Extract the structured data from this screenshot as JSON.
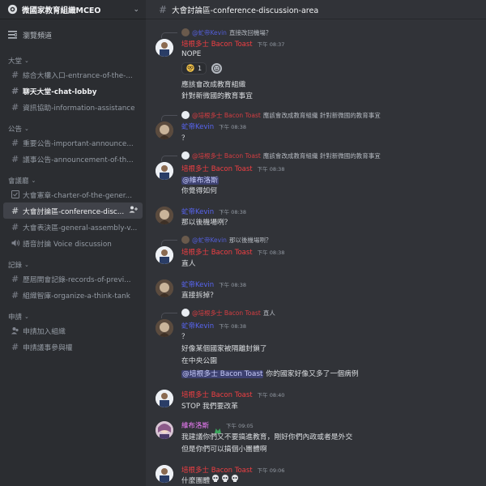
{
  "server": {
    "name": "微國家教育組織MCEO"
  },
  "sidebar": {
    "browse_label": "瀏覽頻道",
    "categories": [
      {
        "label": "大堂"
      },
      {
        "label": "公告"
      },
      {
        "label": "會議廳"
      },
      {
        "label": "記錄"
      },
      {
        "label": "申請"
      }
    ],
    "channels": [
      {
        "label": "綜合大樓入口-entrance-of-the-..."
      },
      {
        "label": "聊天大堂-chat-lobby"
      },
      {
        "label": "資訊協助-information-assistance"
      },
      {
        "label": "重要公告-important-announce..."
      },
      {
        "label": "議事公告-announcement-of-th..."
      },
      {
        "label": "大會憲章-charter-of-the-gener..."
      },
      {
        "label": "大會討論區-conference-disc..."
      },
      {
        "label": "大會表決區-general-assembly-v..."
      },
      {
        "label": "語音討論 Voice discussion"
      },
      {
        "label": "歷屆開會記錄-records-of-previ..."
      },
      {
        "label": "組織智庫-organize-a-think-tank"
      },
      {
        "label": "申請加入組織"
      },
      {
        "label": "申請議事參與權"
      }
    ]
  },
  "header": {
    "channel_title": "大會討論區-conference-discussion-area"
  },
  "users": {
    "bacon": "培根多士 Bacon Toast",
    "kevin": "虻帝Kevin",
    "weibu": "維布洛斯"
  },
  "messages": [
    {
      "reply_name": "@虻帝Kevin",
      "reply_text": "直接改回機場？",
      "time": "下午 08:37",
      "lines": [
        "NOPE"
      ],
      "reaction_count": "1",
      "lines2": [
        "應該會改成教育組織",
        "針對新微國的教育事宜"
      ]
    },
    {
      "reply_name": "@培根多士 Bacon Toast",
      "reply_text": "應該會改成教育組織 針對新微國的教育事宜",
      "time": "下午 08:38",
      "lines": [
        "？"
      ]
    },
    {
      "reply_name": "@培根多士 Bacon Toast",
      "reply_text": "應該會改成教育組織 針對新微國的教育事宜",
      "time": "下午 08:38",
      "mention": "@維布洛斯",
      "lines": [
        "你覺得如何"
      ]
    },
    {
      "time": "下午 08:38",
      "lines": [
        "那以後機場咧？"
      ]
    },
    {
      "reply_name": "@虻帝Kevin",
      "reply_text": "那以後機場咧？",
      "time": "下午 08:38",
      "lines": [
        "直人"
      ]
    },
    {
      "time": "下午 08:38",
      "lines": [
        "直接拆掉？"
      ]
    },
    {
      "reply_name": "@培根多士 Bacon Toast",
      "reply_text": "直人",
      "time": "下午 08:38",
      "lines": [
        "？",
        "好像某個國家被隔離封鎖了",
        "在中央公園"
      ],
      "mention": "@培根多士 Bacon Toast",
      "mention_tail": "你的國家好像又多了一個病例"
    },
    {
      "time": "下午 08:40",
      "lines": [
        "STOP 我們要改革"
      ]
    },
    {
      "time": "下午 09:05",
      "lines": [
        "我建議你們又不要搞進教育，剛好你們內政或者是外交",
        "但是你們可以搞個小團體啊"
      ]
    },
    {
      "time": "下午 09:06",
      "lines": [
        "什麼團體"
      ]
    }
  ],
  "colors": {
    "bacon": "#f23f43",
    "kevin": "#5865f2",
    "weibu": "#f47fff"
  }
}
